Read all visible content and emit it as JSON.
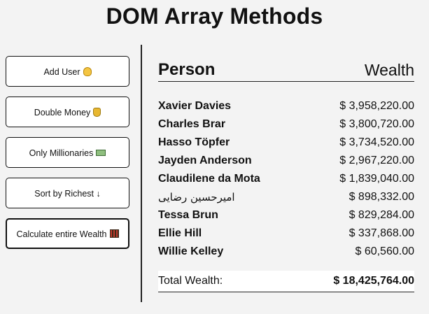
{
  "page": {
    "title": "DOM Array Methods"
  },
  "sidebar": {
    "buttons": [
      {
        "label": "Add User",
        "icon": "man-face-icon"
      },
      {
        "label": "Double Money",
        "icon": "money-bag-icon"
      },
      {
        "label": "Only Millionaries",
        "icon": "dollar-banknote-icon"
      },
      {
        "label": "Sort by Richest ↓",
        "icon": ""
      },
      {
        "label": "Calculate entire Wealth",
        "icon": "abacus-icon"
      }
    ]
  },
  "main": {
    "header": {
      "person": "Person",
      "wealth": "Wealth"
    },
    "rows": [
      {
        "name": "Xavier Davies",
        "amount": "$ 3,958,220.00"
      },
      {
        "name": "Charles Brar",
        "amount": "$ 3,800,720.00"
      },
      {
        "name": "Hasso Töpfer",
        "amount": "$ 3,734,520.00"
      },
      {
        "name": "Jayden Anderson",
        "amount": "$ 2,967,220.00"
      },
      {
        "name": "Claudilene da Mota",
        "amount": "$ 1,839,040.00"
      },
      {
        "name": "امیرحسین رضایی",
        "amount": "$ 898,332.00"
      },
      {
        "name": "Tessa Brun",
        "amount": "$ 829,284.00"
      },
      {
        "name": "Ellie Hill",
        "amount": "$ 337,868.00"
      },
      {
        "name": "Willie Kelley",
        "amount": "$ 60,560.00"
      }
    ],
    "total": {
      "label": "Total Wealth:",
      "value": "$ 18,425,764.00"
    }
  }
}
